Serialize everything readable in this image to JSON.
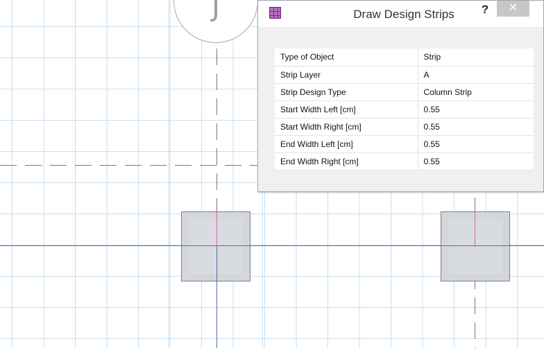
{
  "canvas": {
    "grid_bubble_label": "J"
  },
  "dialog": {
    "title": "Draw Design Strips",
    "help_label": "?",
    "close_label": "✕",
    "properties": [
      {
        "name": "Type of Object",
        "value": "Strip"
      },
      {
        "name": "Strip Layer",
        "value": "A"
      },
      {
        "name": "Strip Design Type",
        "value": "Column Strip"
      },
      {
        "name": "Start Width Left  [cm]",
        "value": "0.55"
      },
      {
        "name": "Start Width Right  [cm]",
        "value": "0.55"
      },
      {
        "name": "End Width Left  [cm]",
        "value": "0.55"
      },
      {
        "name": "End Width Right  [cm]",
        "value": "0.55"
      }
    ]
  },
  "colors": {
    "grid": "#c9dff0",
    "axis": "#5a6f9a",
    "column_fill": "#d3d6db",
    "close_button": "#c7c7c7"
  }
}
